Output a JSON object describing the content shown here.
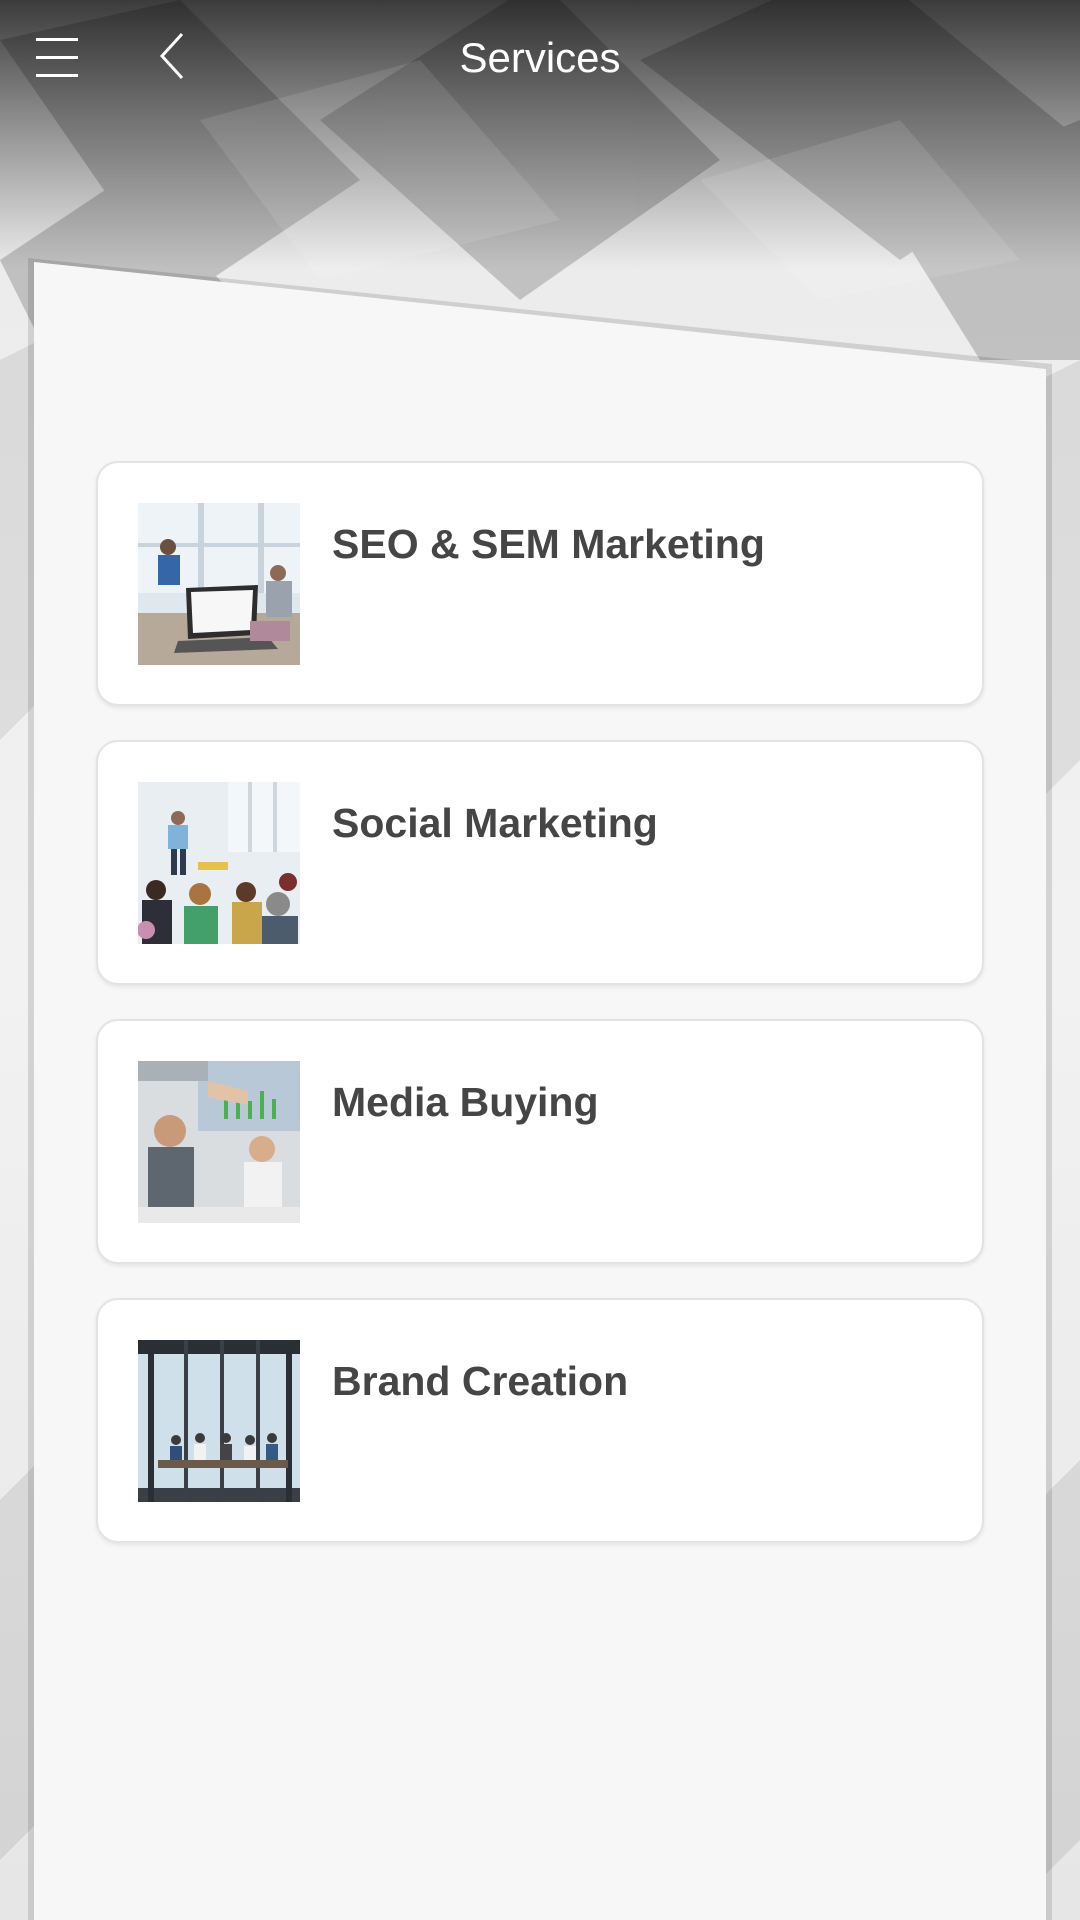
{
  "header": {
    "title": "Services",
    "menu_icon": "hamburger-menu-icon",
    "back_icon": "chevron-left-icon"
  },
  "services": [
    {
      "label": "SEO & SEM Marketing",
      "image": "office-laptop-meeting-photo"
    },
    {
      "label": "Social Marketing",
      "image": "presentation-audience-photo"
    },
    {
      "label": "Media Buying",
      "image": "business-handshake-photo"
    },
    {
      "label": "Brand Creation",
      "image": "conference-room-team-photo"
    }
  ],
  "colors": {
    "header_text": "#ffffff",
    "card_title": "#454545",
    "panel_background": "#f7f7f7",
    "card_background": "#ffffff"
  }
}
